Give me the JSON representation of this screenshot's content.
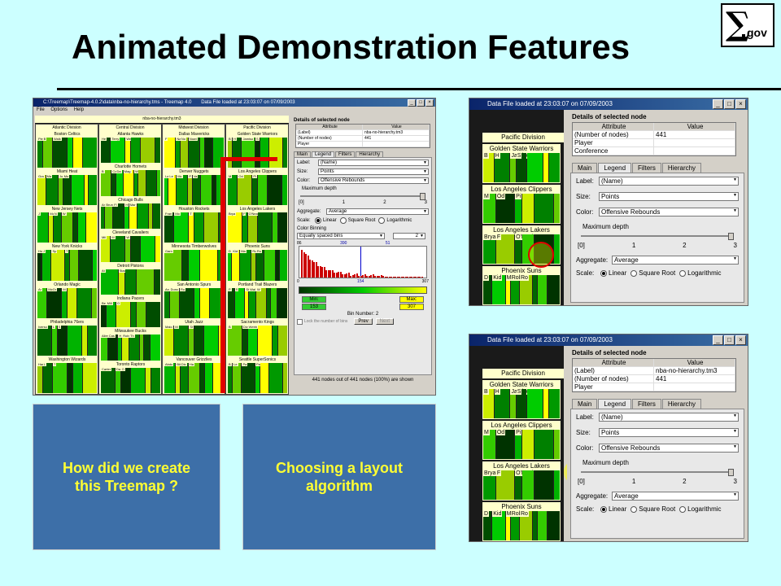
{
  "slide": {
    "title": "Animated Demonstration Features",
    "logo": {
      "symbol": "∑",
      "text": "gov"
    }
  },
  "main_shot": {
    "window_title": "C:\\Treemap\\Treemap-4.0.2\\data\\nba-no-hierarchy.tms - Treemap 4.0",
    "status": "Data File loaded at 23:03:07 on 07/09/2003",
    "menu": [
      "File",
      "Options",
      "Help"
    ],
    "root_label": "nba-no-hierarchy.tm3",
    "divisions": [
      {
        "name": "Atlantic Division",
        "teams": [
          {
            "name": "Boston Celtics",
            "players": [
              "Pierce",
              "B",
              "Walk"
            ]
          },
          {
            "name": "Miami Heat",
            "players": [
              "Gra",
              "Ma",
              "Jo",
              "Mo"
            ]
          },
          {
            "name": "New Jersey Nets",
            "players": [
              "J",
              "Mar",
              "N",
              "W"
            ]
          },
          {
            "name": "New York Knicks",
            "players": [
              "Ho",
              "J",
              "Sp",
              "T"
            ]
          },
          {
            "name": "Orlando Magic",
            "players": [
              "Ar",
              "McGr",
              "M"
            ]
          },
          {
            "name": "Philadelphia 76ers",
            "players": [
              "Iverso",
              "L",
              "S"
            ]
          },
          {
            "name": "Washington Wizards",
            "players": [
              "Ham",
              "L",
              "T"
            ]
          }
        ]
      },
      {
        "name": "Central Division",
        "teams": [
          {
            "name": "Atlanta Hawks",
            "players": [
              "He",
              "Terry",
              "Wri"
            ]
          },
          {
            "name": "Charlotte Hornets",
            "players": [
              "B",
              "Co",
              "Da",
              "Mag",
              "Wesl"
            ]
          },
          {
            "name": "Chicago Bulls",
            "players": [
              "An",
              "Brun",
              "Fi",
              "H",
              "Mar"
            ]
          },
          {
            "name": "Cleveland Cavaliers",
            "players": [
              "Mil",
              "M",
              "W"
            ]
          },
          {
            "name": "Detroit Pistons",
            "players": [
              "At",
              "Stackhou"
            ]
          },
          {
            "name": "Indiana Pacers",
            "players": [
              "Be",
              "Mill",
              "O"
            ]
          },
          {
            "name": "Milwaukee Bucks",
            "players": [
              "Allen",
              "Cas",
              "H",
              "Robi",
              "Th"
            ]
          },
          {
            "name": "Toronto Raptors",
            "players": [
              "Carter",
              "Da",
              "O"
            ]
          }
        ]
      },
      {
        "name": "Midwest Division",
        "teams": [
          {
            "name": "Dallas Mavericks",
            "players": [
              "F",
              "Nash",
              "No",
              "Nowi"
            ]
          },
          {
            "name": "Denver Nuggets",
            "players": [
              "La",
              "Le",
              "Mc",
              "P",
              "Va"
            ]
          },
          {
            "name": "Houston Rockets",
            "players": [
              "Fran",
              "Mo",
              "T"
            ]
          },
          {
            "name": "Minnesota Timberwolves",
            "players": [
              "Garn"
            ]
          },
          {
            "name": "San Antonio Spurs",
            "players": [
              "An",
              "Dunc",
              "Ro"
            ]
          },
          {
            "name": "Utah Jazz",
            "players": [
              "Malo",
              "M",
              "St"
            ]
          },
          {
            "name": "Vancouver Grizzlies",
            "players": [
              "Abdu",
              "Bib",
              "Dic",
              "Ha"
            ]
          }
        ]
      },
      {
        "name": "Pacific Division",
        "teams": [
          {
            "name": "Golden State Warriors",
            "players": [
              "B",
              "H",
              "Jamiso",
              "S"
            ]
          },
          {
            "name": "Los Angeles Clippers",
            "players": [
              "M",
              "Od",
              "Pi"
            ]
          },
          {
            "name": "Los Angeles Lakers",
            "players": [
              "Brya",
              "F",
              "O'Neal"
            ]
          },
          {
            "name": "Phoenix Suns",
            "players": [
              "D",
              "Kid",
              "Ma",
              "Rob",
              "Ro"
            ]
          },
          {
            "name": "Portland Trail Blazers",
            "players": [
              "P",
              "S",
              "St",
              "Wal",
              "W"
            ]
          },
          {
            "name": "Sacramento Kings",
            "players": [
              "B",
              "Divi",
              "Webb"
            ]
          },
          {
            "name": "Seattle SuperSonics",
            "players": [
              "B",
              "Le",
              "Pa",
              "Payto"
            ]
          }
        ]
      }
    ],
    "panel": {
      "details_title": "Details of selected node",
      "attr_header": [
        "Attribute",
        "Value"
      ],
      "attr_rows": [
        [
          "(Label)",
          "nba-no-hierarchy.tm3"
        ],
        [
          "(Number of nodes)",
          "441"
        ],
        [
          "Player",
          ""
        ]
      ],
      "tabs": [
        "Main",
        "Legend",
        "Filters",
        "Hierarchy"
      ],
      "label_lbl": "Label:",
      "label_val": "(Name)",
      "size_lbl": "Size:",
      "size_val": "Points",
      "color_lbl": "Color:",
      "color_val": "Offensive Rebounds",
      "maxdepth_lbl": "Maximum depth",
      "depth_ticks": [
        "[0]",
        "1",
        "2",
        "3"
      ],
      "aggregate_lbl": "Aggregate:",
      "aggregate_val": "Average",
      "scale_lbl": "Scale:",
      "scale_opts": [
        "Linear",
        "Square Root",
        "Logarithmic"
      ],
      "binning_title": "Color Binning",
      "binning_val": "Equally spaced bins",
      "bins_count": "2",
      "hist_top": [
        "86",
        "390",
        "51"
      ],
      "hist_bottom": [
        "0",
        "154",
        "307"
      ],
      "min_lbl": "Min:",
      "min_val": "153",
      "max_lbl": "Max:",
      "max_val": "307",
      "bin_number": "Bin Number: 2",
      "lock_lbl": "Lock the number of bins",
      "prev": "Prev",
      "next": "Next",
      "footer": "441 nodes out of 441 nodes (100%) are shown"
    }
  },
  "slide_buttons": [
    {
      "text": "How did we create\nthis Treemap ?"
    },
    {
      "text": "Choosing a layout\nalgorithm"
    }
  ],
  "zoom_top": {
    "status": "Data File loaded at 23:03:07 on 07/09/2003",
    "division": "Pacific Division",
    "teams": [
      {
        "name": "Golden State Warriors",
        "players": [
          "B",
          "H",
          "Jamiso",
          "S"
        ]
      },
      {
        "name": "Los Angeles Clippers",
        "players": [
          "M",
          "Od",
          "Pi"
        ]
      },
      {
        "name": "Los Angeles Lakers",
        "players": [
          "Brya",
          "F",
          "O'Neal"
        ]
      },
      {
        "name": "Phoenix Suns",
        "players": [
          "D",
          "Kid",
          "Ma",
          "Rob",
          "Ro"
        ]
      }
    ],
    "details_title": "Details of selected node",
    "attr_header": [
      "Attribute",
      "Value"
    ],
    "attr_rows": [
      [
        "(Number of nodes)",
        "441"
      ],
      [
        "Player",
        ""
      ],
      [
        "Conference",
        ""
      ]
    ],
    "tabs": [
      "Main",
      "Legend",
      "Filters",
      "Hierarchy"
    ],
    "label_lbl": "Label:",
    "label_val": "(Name)",
    "size_lbl": "Size:",
    "size_val": "Points",
    "color_lbl": "Color:",
    "color_val": "Offensive Rebounds",
    "maxdepth_lbl": "Maximum depth",
    "depth_ticks": [
      "[0]",
      "1",
      "2",
      "3"
    ],
    "aggregate_lbl": "Aggregate:",
    "aggregate_val": "Average",
    "scale_lbl": "Scale:",
    "scale_opts": [
      "Linear",
      "Square Root",
      "Logarithmic"
    ]
  },
  "zoom_bottom": {
    "status": "Data File loaded at 23:03:07 on 07/09/2003",
    "division": "Pacific Division",
    "teams": [
      {
        "name": "Golden State Warriors",
        "players": [
          "B",
          "H",
          "Jamiso",
          "S"
        ]
      },
      {
        "name": "Los Angeles Clippers",
        "players": [
          "M",
          "Od",
          "Pi"
        ]
      },
      {
        "name": "Los Angeles Lakers",
        "players": [
          "Brya",
          "F",
          "O'Neal"
        ]
      },
      {
        "name": "Phoenix Suns",
        "players": [
          "D",
          "Kid",
          "Ma",
          "Rob",
          "Ro"
        ]
      }
    ],
    "details_title": "Details of selected node",
    "attr_header": [
      "Attribute",
      "Value"
    ],
    "attr_rows": [
      [
        "(Label)",
        "nba-no-hierarchy.tm3"
      ],
      [
        "(Number of nodes)",
        "441"
      ],
      [
        "Player",
        ""
      ]
    ],
    "tabs": [
      "Main",
      "Legend",
      "Filters",
      "Hierarchy"
    ],
    "label_lbl": "Label:",
    "label_val": "(Name)",
    "size_lbl": "Size:",
    "size_val": "Points",
    "color_lbl": "Color:",
    "color_val": "Offensive Rebounds",
    "maxdepth_lbl": "Maximum depth",
    "depth_ticks": [
      "[0]",
      "1",
      "2",
      "3"
    ],
    "aggregate_lbl": "Aggregate:",
    "aggregate_val": "Average",
    "scale_lbl": "Scale:",
    "scale_opts": [
      "Linear",
      "Square Root",
      "Logarithmic"
    ]
  },
  "colors": {
    "background": "#ccffff",
    "slide_button": "#3d6fa8",
    "slide_text": "#ffff33",
    "highlight": "#ff0000"
  }
}
